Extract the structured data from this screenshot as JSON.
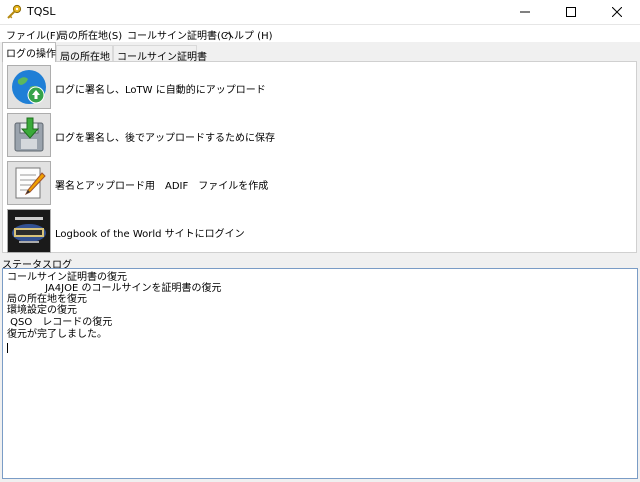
{
  "window": {
    "title": "TQSL",
    "icon": "key-icon",
    "controls": [
      "minimize-icon",
      "maximize-icon",
      "close-icon"
    ]
  },
  "menu": [
    {
      "label": "ファイル(F)"
    },
    {
      "label": "局の所在地(S)"
    },
    {
      "label": "コールサイン証明書(C)"
    },
    {
      "label": "ヘルプ (H)"
    }
  ],
  "tabs": [
    {
      "label": "ログの操作",
      "active": true
    },
    {
      "label": "局の所在地",
      "active": false
    },
    {
      "label": "コールサイン証明書",
      "active": false
    }
  ],
  "actions": [
    {
      "label": "ログに署名し、LoTW に自動的にアップロード",
      "icon": "globe-upload-icon"
    },
    {
      "label": "ログを署名し、後でアップロードするために保存",
      "icon": "save-disk-icon"
    },
    {
      "label": "署名とアップロード用　ADIF　ファイルを作成",
      "icon": "edit-document-icon"
    },
    {
      "label": "Logbook of the World サイトにログイン",
      "icon": "lotw-logo-icon"
    }
  ],
  "status": {
    "label": "ステータスログ",
    "lines": [
      "コールサイン証明書の復元",
      "            JA4JOE のコールサインを証明書の復元",
      "局の所在地を復元",
      "環境設定の復元",
      " QSO　レコードの復元",
      "復元が完了しました。"
    ]
  },
  "colors": {
    "title_bar": "#ffffff",
    "window_bg": "#f0f0f0",
    "status_border": "#7a9cc6"
  }
}
